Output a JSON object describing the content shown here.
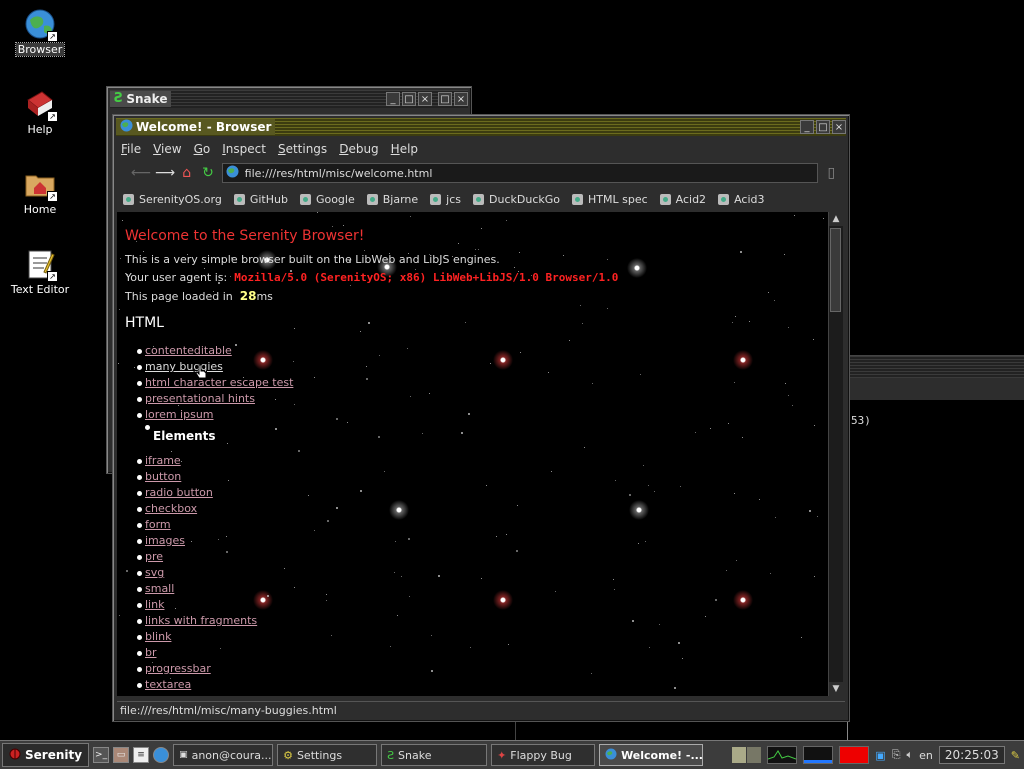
{
  "desktop": {
    "icons": [
      {
        "label": "Browser"
      },
      {
        "label": "Help"
      },
      {
        "label": "Home"
      },
      {
        "label": "Text Editor"
      }
    ]
  },
  "snake_window": {
    "title": "Snake"
  },
  "background_window": {
    "partial_text": "53)"
  },
  "browser": {
    "title": "Welcome! - Browser",
    "menu": [
      "File",
      "View",
      "Go",
      "Inspect",
      "Settings",
      "Debug",
      "Help"
    ],
    "url": "file:///res/html/misc/welcome.html",
    "bookmarks": [
      "SerenityOS.org",
      "GitHub",
      "Google",
      "Bjarne",
      "jcs",
      "DuckDuckGo",
      "HTML spec",
      "Acid2",
      "Acid3"
    ],
    "status": "file:///res/html/misc/many-buggies.html",
    "page": {
      "heading": "Welcome to the Serenity Browser!",
      "intro": "This is a very simple browser built on the LibWeb and LibJS engines.",
      "ua_label": "Your user agent is:",
      "ua_value": "Mozilla/5.0 (SerenityOS; x86) LibWeb+LibJS/1.0 Browser/1.0",
      "loaded_prefix": "This page loaded in",
      "loaded_value": "28",
      "loaded_unit": "ms",
      "html_heading": "HTML",
      "html_links": [
        "contenteditable",
        "many buggies",
        "html character escape test",
        "presentational hints",
        "lorem ipsum"
      ],
      "elements_heading": "Elements",
      "element_links": [
        "iframe",
        "button",
        "radio button",
        "checkbox",
        "form",
        "images",
        "pre",
        "svg",
        "small",
        "link",
        "links with fragments",
        "blink",
        "br",
        "progressbar",
        "textarea"
      ]
    }
  },
  "taskbar": {
    "start_label": "Serenity",
    "tasks": [
      {
        "label": "anon@coura..."
      },
      {
        "label": "Settings"
      },
      {
        "label": "Snake"
      },
      {
        "label": "Flappy Bug"
      },
      {
        "label": "Welcome! -..."
      }
    ],
    "keyboard_layout": "en",
    "clock": "20:25:03"
  },
  "colors": {
    "active_title": "#585820",
    "link": "#cc99aa",
    "heading_red": "#ee3333",
    "ua_red": "#ff2222"
  }
}
